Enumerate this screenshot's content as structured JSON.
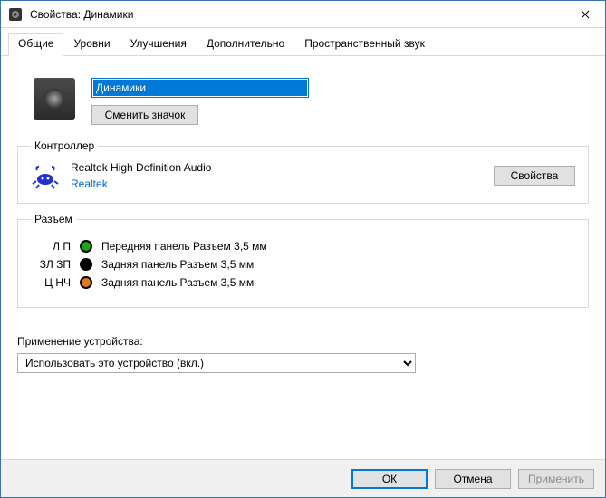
{
  "window": {
    "title": "Свойства: Динамики"
  },
  "tabs": [
    "Общие",
    "Уровни",
    "Улучшения",
    "Дополнительно",
    "Пространственный звук"
  ],
  "device": {
    "name": "Динамики",
    "change_icon": "Сменить значок"
  },
  "controller": {
    "legend": "Контроллер",
    "name": "Realtek High Definition Audio",
    "vendor": "Realtek",
    "properties_btn": "Свойства"
  },
  "jacks": {
    "legend": "Разъем",
    "items": [
      {
        "label": "Л П",
        "color": "#1aa81a",
        "desc": "Передняя панель Разъем 3,5 мм"
      },
      {
        "label": "ЗЛ ЗП",
        "color": "#000000",
        "desc": "Задняя панель Разъем 3,5 мм"
      },
      {
        "label": "Ц НЧ",
        "color": "#e07a1f",
        "desc": "Задняя панель Разъем 3,5 мм"
      }
    ]
  },
  "usage": {
    "label": "Применение устройства:",
    "selected": "Использовать это устройство (вкл.)"
  },
  "buttons": {
    "ok": "ОК",
    "cancel": "Отмена",
    "apply": "Применить"
  }
}
